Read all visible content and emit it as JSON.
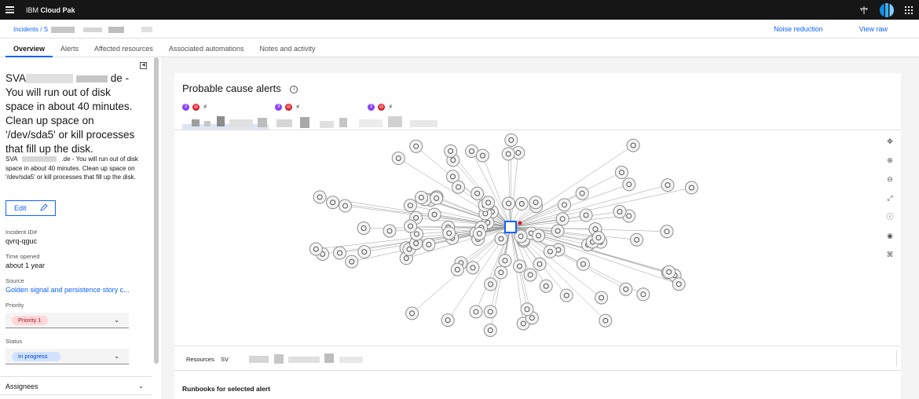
{
  "topbar": {
    "brand_prefix": "IBM",
    "brand_name": "Cloud Pak",
    "icons": [
      "hamburger-icon",
      "topology-icon",
      "avatar-globe",
      "app-switcher-icon"
    ]
  },
  "breadcrumb": {
    "root": "Incidents",
    "separator": "/ S"
  },
  "header_actions": {
    "noise_reduction": "Noise reduction",
    "view_raw": "View raw"
  },
  "tabs": [
    {
      "label": "Overview",
      "active": true
    },
    {
      "label": "Alerts",
      "active": false
    },
    {
      "label": "Affected resources",
      "active": false
    },
    {
      "label": "Associated automations",
      "active": false
    },
    {
      "label": "Notes and activity",
      "active": false
    }
  ],
  "incident": {
    "title_prefix": "SVA",
    "title_suffix": "de",
    "title_body": "- You will run out of disk space in about 40 minutes. Clean up space on '/dev/sda5' or kill processes that fill up the disk.",
    "desc_prefix": "SVA",
    "desc_suffix": ".de - You will",
    "desc_body": "run out of disk space in about 40 minutes. Clean up space on '/dev/sda5' or kill processes that fill up the disk.",
    "edit_label": "Edit",
    "id_label": "Incident ID#",
    "id_value": "qvrq-qguc",
    "time_label": "Time opened",
    "time_value": "about 1 year",
    "source_label": "Source",
    "source_value": "Golden signal and persistence story c...",
    "priority_label": "Priority",
    "priority_value": "Priority 1",
    "status_label": "Status",
    "status_value": "In progress",
    "assignees_label": "Assignees"
  },
  "probable_cause": {
    "title": "Probable cause alerts",
    "alert_badge_count": "3",
    "resources_label": "Resources",
    "resources_value": "SV",
    "runbooks_title": "Runbooks for selected alert"
  },
  "graph_tools": [
    "move-icon",
    "zoom-in-icon",
    "zoom-out-icon",
    "fit-to-screen-icon",
    "info-icon",
    "location-icon",
    "expand-nodes-icon"
  ],
  "colors": {
    "accent": "#0f62fe",
    "topbar": "#161616",
    "priority_red": "#da1e28",
    "badge_purple": "#8a3ffc"
  }
}
